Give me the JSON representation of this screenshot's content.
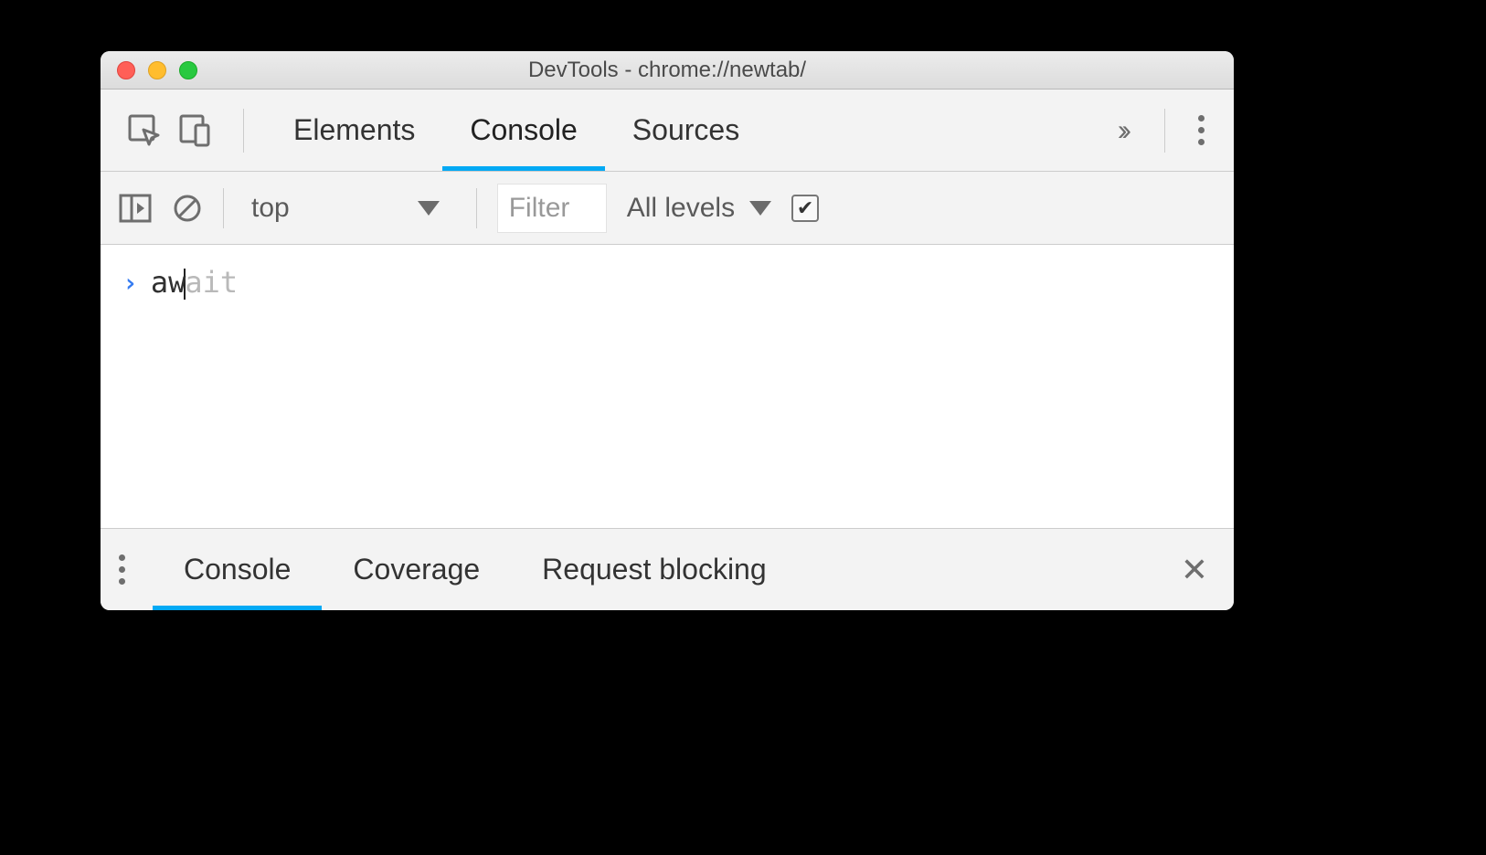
{
  "window": {
    "title": "DevTools - chrome://newtab/"
  },
  "tabs": {
    "elements": "Elements",
    "console": "Console",
    "sources": "Sources"
  },
  "sub": {
    "context": "top",
    "filter_placeholder": "Filter",
    "levels": "All levels"
  },
  "console": {
    "typed": "aw",
    "suggestion": "ait"
  },
  "drawer": {
    "console": "Console",
    "coverage": "Coverage",
    "request_blocking": "Request blocking"
  }
}
